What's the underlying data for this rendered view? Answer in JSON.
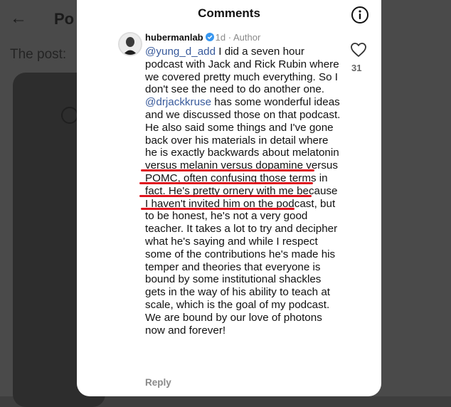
{
  "background": {
    "back_glyph": "←",
    "title_fragment": "Po",
    "post_fragment": "The post:"
  },
  "header": {
    "title": "Comments",
    "info_icon": "info-circle-icon"
  },
  "comment": {
    "username": "hubermanlab",
    "verified": true,
    "separator": "·",
    "age": "1d",
    "role": "Author",
    "mention1": "@yung_d_add",
    "text1": " I did a seven hour podcast with Jack and Rick Rubin where we covered pretty much everything. So I don't see the need to do another one. ",
    "mention2": "@drjackkruse",
    "text2": " has some wonderful ideas and we discussed those on that podcast. He also said some things and I've gone back over his materials in detail where he is exactly backwards about melatonin versus melanin versus dopamine versus POMC, often confusing those terms in fact. He's pretty ornery with me because I haven't invited him on the podcast, but to be honest, he's not a very good teacher. It takes a lot to try and decipher what he's saying and while I respect some of the contributions he's made his temper and theories that everyone is bound by some institutional shackles gets in the way of his ability to teach at scale, which is the goal of my podcast. We are bound by our love of photons now and forever!",
    "like_count": "31",
    "reply_label": "Reply"
  },
  "colors": {
    "mention": "#385a9b",
    "annotation_underline": "#e0141e",
    "verified": "#3897f0"
  }
}
